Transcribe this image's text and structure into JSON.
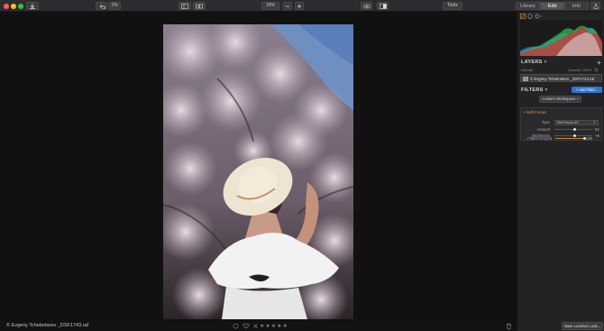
{
  "window": {
    "traffic_colors": [
      "#ff5f57",
      "#febc2e",
      "#28c840"
    ]
  },
  "toolbar": {
    "zoom_value": "1%",
    "zoom_percent": "15%",
    "tools_label": "Tools",
    "tabs": [
      {
        "label": "Library",
        "active": false
      },
      {
        "label": "Edit",
        "active": true
      },
      {
        "label": "Info",
        "active": false
      }
    ]
  },
  "bottombar": {
    "filename": "© Evgeny Tchebotarev _DSF1743.raf",
    "stars": "★★★★★"
  },
  "panel": {
    "layers_title": "LAYERS",
    "blend_mode": "Normal",
    "opacity_label": "Opacity: 100%",
    "layer_name": "© Evgeny Tchebotarev _DSF1743.raf",
    "filters_title": "FILTERS",
    "add_filter_label": "+ Add Filter...",
    "workspace_label": "Custom Workspace",
    "filter": {
      "name": "Soft Focus",
      "type_label": "Type",
      "type_value": "Soft Focus #2",
      "amount_label": "Amount",
      "amount_value": "54",
      "amount_fraction": 0.54,
      "brightness_label": "Brightness",
      "brightness_value": "+6",
      "brightness_fraction": 0.53
    },
    "filters_amount_label": "Filters Amount",
    "filters_amount_value": "100",
    "filters_amount_fraction": 1.0,
    "save_look_label": "Save Luminar Look..."
  }
}
